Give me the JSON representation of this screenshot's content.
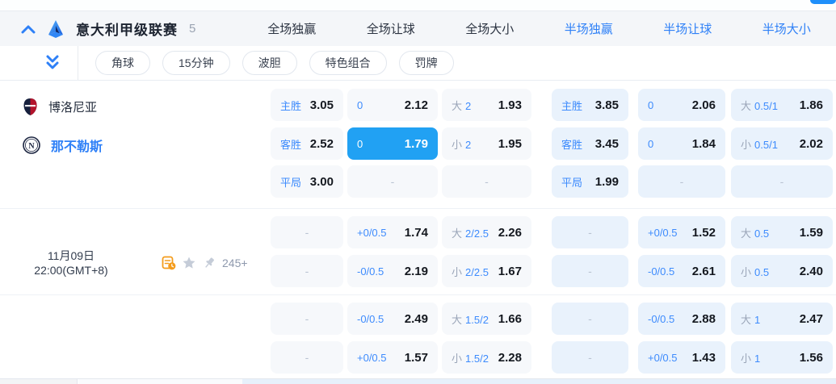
{
  "header": {
    "league": "意大利甲级联赛",
    "count": "5",
    "tabs": [
      {
        "label": "全场独赢",
        "active": false
      },
      {
        "label": "全场让球",
        "active": false
      },
      {
        "label": "全场大小",
        "active": false
      },
      {
        "label": "半场独赢",
        "active": true
      },
      {
        "label": "半场让球",
        "active": true
      },
      {
        "label": "半场大小",
        "active": true
      }
    ]
  },
  "filters": {
    "pills": [
      {
        "label": "角球"
      },
      {
        "label": "15分钟"
      },
      {
        "label": "波胆"
      },
      {
        "label": "特色组合"
      },
      {
        "label": "罚牌"
      }
    ]
  },
  "match": {
    "home_team": "博洛尼亚",
    "away_team": "那不勒斯",
    "date": "11月09日",
    "time": "22:00(GMT+8)",
    "more_markets": "245+"
  },
  "colors": {
    "accent_blue": "#2e80f7",
    "selected_cell": "#21a1f3",
    "ft_cell_bg": "#f6f8fb",
    "ht_cell_bg": "#e9f2fc",
    "odds_text": "#14181f",
    "gray_label": "#9aa5b8"
  },
  "odds": {
    "columns": [
      {
        "market": "全场独赢",
        "group": "ft",
        "cells": [
          {
            "blue": "主胜",
            "value": "3.05"
          },
          {
            "blue": "客胜",
            "value": "2.52"
          },
          {
            "blue": "平局",
            "value": "3.00"
          },
          {
            "dash": "-"
          },
          {
            "dash": "-"
          },
          {
            "dash": "-"
          },
          {
            "dash": "-"
          }
        ]
      },
      {
        "market": "全场让球",
        "group": "ft",
        "cells": [
          {
            "blue": "0",
            "value": "2.12"
          },
          {
            "blue": "0",
            "value": "1.79",
            "selected": true
          },
          {
            "dash": "-"
          },
          {
            "blue": "+0/0.5",
            "value": "1.74"
          },
          {
            "blue": "-0/0.5",
            "value": "2.19"
          },
          {
            "blue": "-0/0.5",
            "value": "2.49"
          },
          {
            "blue": "+0/0.5",
            "value": "1.57"
          }
        ]
      },
      {
        "market": "全场大小",
        "group": "ft",
        "cells": [
          {
            "gray": "大",
            "blue": "2",
            "value": "1.93"
          },
          {
            "gray": "小",
            "blue": "2",
            "value": "1.95"
          },
          {
            "dash": "-"
          },
          {
            "gray": "大",
            "blue": "2/2.5",
            "value": "2.26"
          },
          {
            "gray": "小",
            "blue": "2/2.5",
            "value": "1.67"
          },
          {
            "gray": "大",
            "blue": "1.5/2",
            "value": "1.66"
          },
          {
            "gray": "小",
            "blue": "1.5/2",
            "value": "2.28"
          }
        ]
      },
      {
        "market": "半场独赢",
        "group": "ht",
        "cells": [
          {
            "blue": "主胜",
            "value": "3.85"
          },
          {
            "blue": "客胜",
            "value": "3.45"
          },
          {
            "blue": "平局",
            "value": "1.99"
          },
          {
            "dash": "-"
          },
          {
            "dash": "-"
          },
          {
            "dash": "-"
          },
          {
            "dash": "-"
          }
        ]
      },
      {
        "market": "半场让球",
        "group": "ht",
        "cells": [
          {
            "blue": "0",
            "value": "2.06"
          },
          {
            "blue": "0",
            "value": "1.84"
          },
          {
            "dash": "-"
          },
          {
            "blue": "+0/0.5",
            "value": "1.52"
          },
          {
            "blue": "-0/0.5",
            "value": "2.61"
          },
          {
            "blue": "-0/0.5",
            "value": "2.88"
          },
          {
            "blue": "+0/0.5",
            "value": "1.43"
          }
        ]
      },
      {
        "market": "半场大小",
        "group": "ht",
        "cells": [
          {
            "gray": "大",
            "blue": "0.5/1",
            "value": "1.86"
          },
          {
            "gray": "小",
            "blue": "0.5/1",
            "value": "2.02"
          },
          {
            "dash": "-"
          },
          {
            "gray": "大",
            "blue": "0.5",
            "value": "1.59"
          },
          {
            "gray": "小",
            "blue": "0.5",
            "value": "2.40"
          },
          {
            "gray": "大",
            "blue": "1",
            "value": "2.47"
          },
          {
            "gray": "小",
            "blue": "1",
            "value": "1.56"
          }
        ]
      }
    ]
  }
}
